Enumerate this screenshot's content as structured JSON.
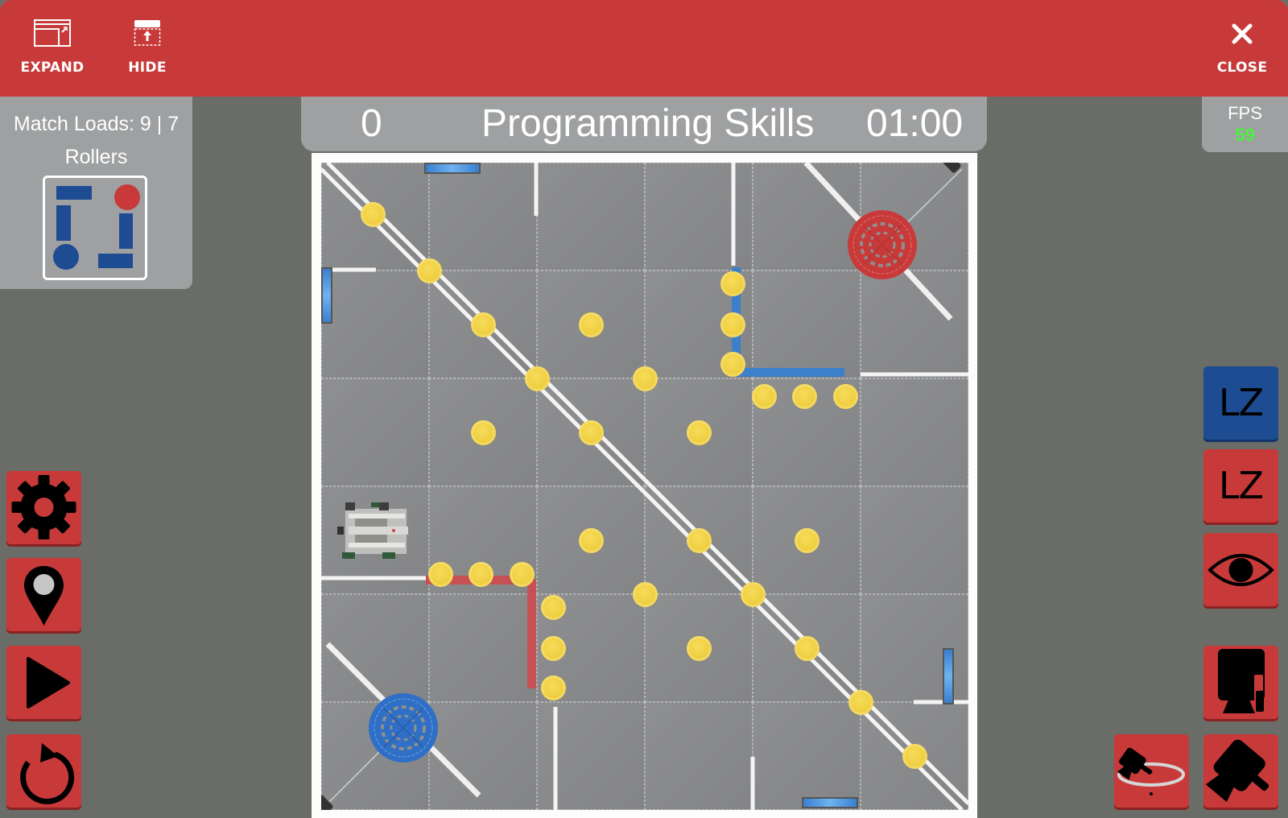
{
  "topbar": {
    "expand_label": "EXPAND",
    "hide_label": "HIDE",
    "close_label": "CLOSE"
  },
  "left_panel": {
    "match_loads_label": "Match Loads: 9 | 7",
    "rollers_label": "Rollers",
    "rollers": [
      {
        "id": "top",
        "shape": "bar",
        "color": "#1e4c92"
      },
      {
        "id": "left",
        "shape": "bar",
        "color": "#1e4c92"
      },
      {
        "id": "top-right",
        "shape": "circle",
        "color": "#c83a3a"
      },
      {
        "id": "right",
        "shape": "bar",
        "color": "#1e4c92"
      },
      {
        "id": "bottom-left",
        "shape": "circle",
        "color": "#1e4c92"
      },
      {
        "id": "bottom",
        "shape": "bar",
        "color": "#1e4c92"
      }
    ]
  },
  "scoreboard": {
    "score": "0",
    "mode": "Programming Skills",
    "timer": "01:00"
  },
  "fps": {
    "label": "FPS",
    "value": "59"
  },
  "colors": {
    "accent_red": "#c83a3a",
    "accent_blue": "#1e4c92",
    "fps_green": "#4cf040",
    "background": "#6a6c67",
    "panel_gray": "#9ea0a2"
  },
  "field": {
    "tiles_per_side": 6,
    "discs_field_tiles": [
      [
        0.48,
        0.48
      ],
      [
        1.0,
        1.0
      ],
      [
        1.5,
        1.5
      ],
      [
        2.0,
        2.0
      ],
      [
        2.5,
        1.5
      ],
      [
        3.0,
        2.0
      ],
      [
        3.82,
        1.12
      ],
      [
        3.82,
        1.5
      ],
      [
        3.82,
        1.87
      ],
      [
        4.11,
        2.17
      ],
      [
        4.48,
        2.17
      ],
      [
        4.86,
        2.17
      ],
      [
        1.5,
        2.5
      ],
      [
        2.5,
        2.5
      ],
      [
        3.5,
        2.5
      ],
      [
        2.5,
        3.5
      ],
      [
        3.5,
        3.5
      ],
      [
        4.5,
        3.5
      ],
      [
        1.11,
        3.82
      ],
      [
        1.48,
        3.82
      ],
      [
        1.86,
        3.82
      ],
      [
        2.15,
        4.12
      ],
      [
        2.15,
        4.5
      ],
      [
        2.15,
        4.87
      ],
      [
        3.0,
        4.0
      ],
      [
        4.0,
        4.0
      ],
      [
        3.5,
        4.5
      ],
      [
        4.5,
        4.5
      ],
      [
        5.0,
        5.0
      ],
      [
        5.5,
        5.5
      ]
    ],
    "red_goal": [
      5.2,
      0.76
    ],
    "blue_goal": [
      0.76,
      5.24
    ],
    "robot": [
      0.5,
      3.42
    ]
  },
  "side_buttons": {
    "settings": "settings",
    "position": "position",
    "play": "play",
    "reset": "reset",
    "lz_blue_label": "LZ",
    "lz_red_label": "LZ",
    "view": "view",
    "camera_robot": "camera-robot",
    "camera_orbit": "camera-orbit",
    "camera_follow": "camera-follow"
  }
}
